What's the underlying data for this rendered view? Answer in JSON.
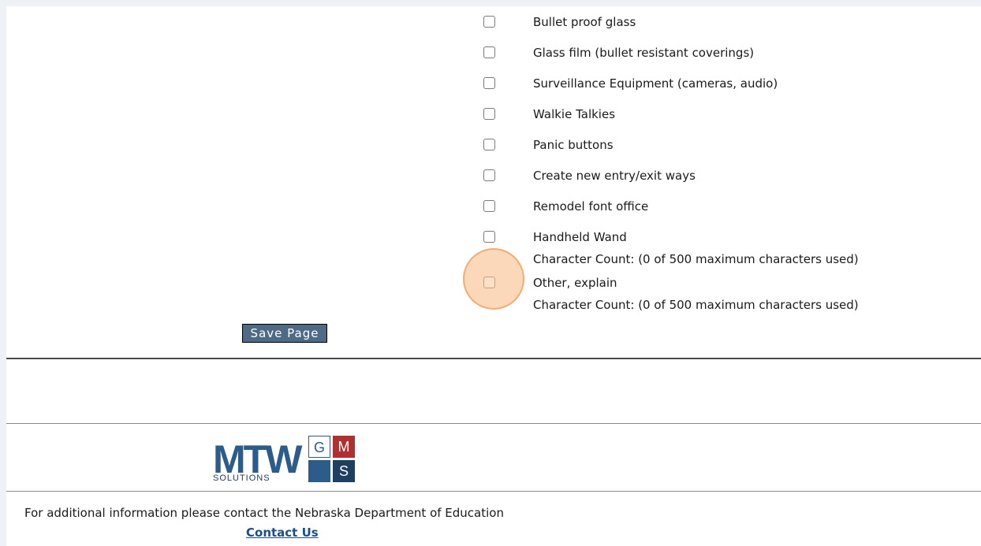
{
  "options": [
    {
      "label": "Bullet proof glass",
      "checked": false
    },
    {
      "label": "Glass film (bullet resistant coverings)",
      "checked": false
    },
    {
      "label": "Surveillance Equipment (cameras, audio)",
      "checked": false
    },
    {
      "label": "Walkie Talkies",
      "checked": false
    },
    {
      "label": "Panic buttons",
      "checked": false
    },
    {
      "label": "Create new entry/exit ways",
      "checked": false
    },
    {
      "label": "Remodel font office",
      "checked": false
    },
    {
      "label": "Handheld Wand",
      "checked": false
    },
    {
      "label": "Other, explain",
      "checked": false
    }
  ],
  "character_count": {
    "handheld_wand": "Character Count: (0 of 500 maximum characters used)",
    "other": "Character Count: (0 of 500 maximum characters used)"
  },
  "save_button_label": "Save Page",
  "logo": {
    "main": "MTW",
    "sub": "SOLUTIONS",
    "grid_g": "G",
    "grid_m": "M",
    "grid_s": "S"
  },
  "footer": {
    "info_text": "For additional information please contact the Nebraska Department of Education",
    "contact_link": "Contact Us"
  },
  "colors": {
    "button_bg": "#4f6a85",
    "highlight": "#f8b880",
    "link": "#1d4d8a",
    "logo_blue": "#2b5c8a",
    "logo_red": "#b03030"
  }
}
